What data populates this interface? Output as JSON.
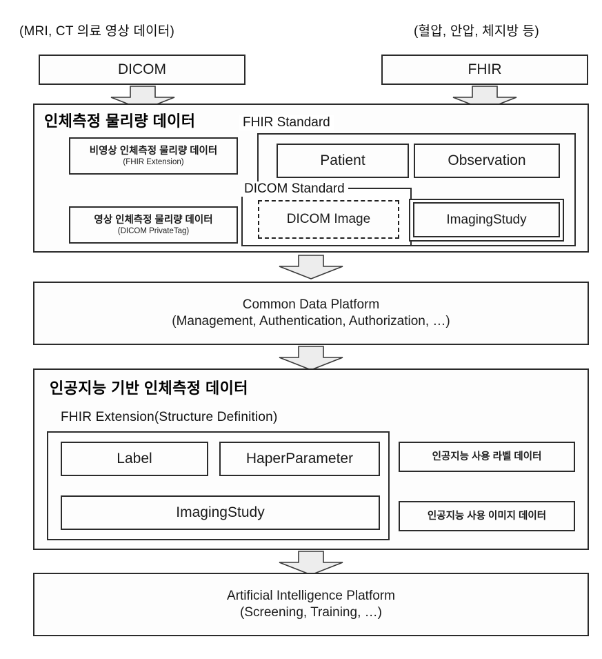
{
  "diagram": {
    "top_captions": {
      "left": "(MRI, CT 의료 영상 데이터)",
      "right": "(혈압, 안압, 체지방 등)"
    },
    "sources": {
      "dicom": "DICOM",
      "fhir": "FHIR"
    },
    "measurement_section": {
      "title": "인체측정 물리량 데이터",
      "left_boxes": [
        {
          "line1": "비영상 인체측정 물리량 데이터",
          "line2": "(FHIR Extension)"
        },
        {
          "line1": "영상 인체측정 물리량 데이터",
          "line2": "(DICOM PrivateTag)"
        }
      ],
      "fhir_standard_label": "FHIR Standard",
      "dicom_standard_label": "DICOM Standard",
      "resources": {
        "patient": "Patient",
        "observation": "Observation",
        "dicom_image": "DICOM Image",
        "imaging_study": "ImagingStudy"
      }
    },
    "common_platform": {
      "line1": "Common Data Platform",
      "line2": "(Management, Authentication, Authorization, …)"
    },
    "ai_section": {
      "title": "인공지능 기반 인체측정 데이터",
      "subtitle": "FHIR Extension(Structure  Definition)",
      "inner_boxes": {
        "label": "Label",
        "haper_parameter": "HaperParameter",
        "imaging_study": "ImagingStudy"
      },
      "right_boxes": [
        "인공지능 사용 라벨 데이터",
        "인공지능 사용 이미지 데이터"
      ]
    },
    "ai_platform": {
      "line1": "Artificial  Intelligence  Platform",
      "line2": "(Screening, Training, …)"
    },
    "colors": {
      "stroke": "#2b2b2b",
      "arrow_fill": "#ededed",
      "arrow_stroke": "#3a3a3a",
      "background": "#ffffff"
    },
    "arrows": [
      {
        "name": "arrow-dicom-to-measurement"
      },
      {
        "name": "arrow-fhir-to-measurement"
      },
      {
        "name": "arrow-measurement-to-platform"
      },
      {
        "name": "arrow-platform-to-ai"
      },
      {
        "name": "arrow-ai-to-ai-platform"
      }
    ]
  }
}
